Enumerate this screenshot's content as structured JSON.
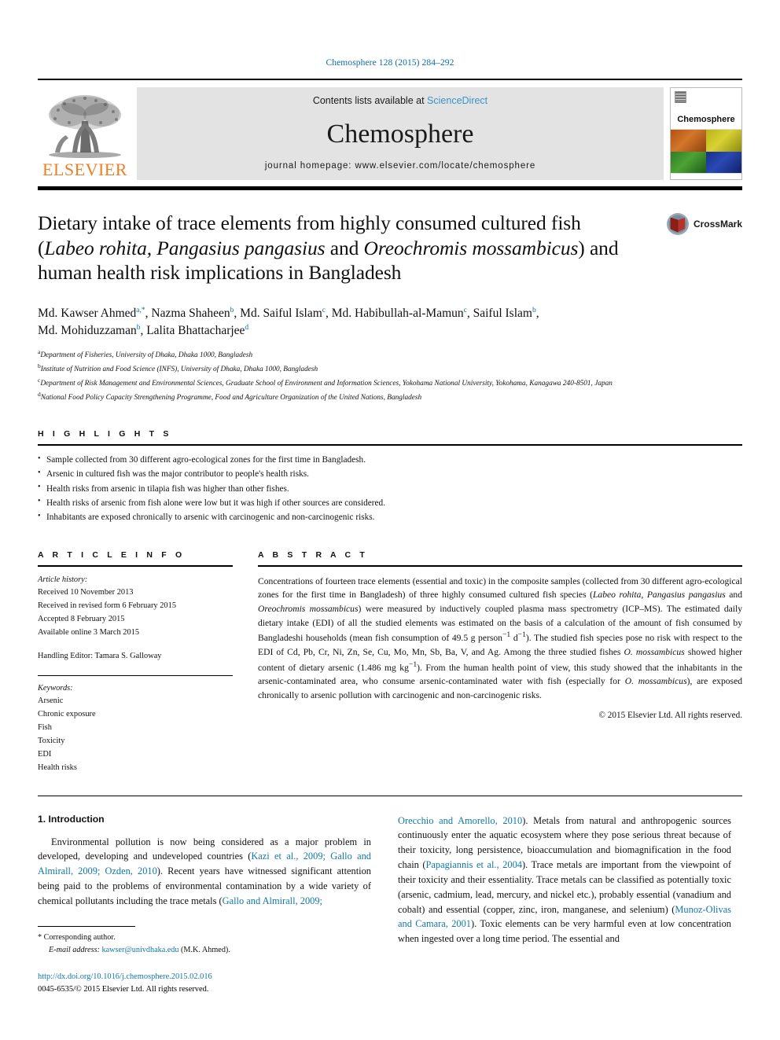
{
  "running_head": "Chemosphere 128 (2015) 284–292",
  "masthead": {
    "publisher_name": "ELSEVIER",
    "contents_prefix": "Contents lists available at",
    "sciencedirect": "ScienceDirect",
    "journal_name": "Chemosphere",
    "homepage": "journal homepage: www.elsevier.com/locate/chemosphere",
    "cover_title": "Chemosphere"
  },
  "title": {
    "line1": "Dietary intake of trace elements from highly consumed cultured fish",
    "line2_pre": "(",
    "line2_it1": "Labeo rohita, Pangasius pangasius",
    "line2_mid": " and ",
    "line2_it2": "Oreochromis mossambicus",
    "line2_post": ") and",
    "line3": "human health risk implications in Bangladesh",
    "crossmark_label": "CrossMark"
  },
  "authors": {
    "list": [
      {
        "name": "Md. Kawser Ahmed",
        "sup": "a,*",
        "sep": ", "
      },
      {
        "name": "Nazma Shaheen",
        "sup": "b",
        "sep": ", "
      },
      {
        "name": "Md. Saiful Islam",
        "sup": "c",
        "sep": ", "
      },
      {
        "name": "Md. Habibullah-al-Mamun",
        "sup": "c",
        "sep": ", "
      },
      {
        "name": "Saiful Islam",
        "sup": "b",
        "sep": ", "
      },
      {
        "name": "Md. Mohiduzzaman",
        "sup": "b",
        "sep": ", "
      },
      {
        "name": "Lalita Bhattacharjee",
        "sup": "d",
        "sep": ""
      }
    ]
  },
  "affiliations": [
    {
      "marker": "a",
      "text": "Department of Fisheries, University of Dhaka, Dhaka 1000, Bangladesh"
    },
    {
      "marker": "b",
      "text": "Institute of Nutrition and Food Science (INFS), University of Dhaka, Dhaka 1000, Bangladesh"
    },
    {
      "marker": "c",
      "text": "Department of Risk Management and Environmental Sciences, Graduate School of Environment and Information Sciences, Yokohama National University, Yokohama, Kanagawa 240-8501, Japan"
    },
    {
      "marker": "d",
      "text": "National Food Policy Capacity Strengthening Programme, Food and Agriculture Organization of the United Nations, Bangladesh"
    }
  ],
  "highlights": {
    "label": "H I G H L I G H T S",
    "items": [
      "Sample collected from 30 different agro-ecological zones for the first time in Bangladesh.",
      "Arsenic in cultured fish was the major contributor to people's health risks.",
      "Health risks from arsenic in tilapia fish was higher than other fishes.",
      "Health risks of arsenic from fish alone were low but it was high if other sources are considered.",
      "Inhabitants are exposed chronically to arsenic with carcinogenic and non-carcinogenic risks."
    ]
  },
  "article_info": {
    "label": "A R T I C L E  I N F O",
    "history_title": "Article history:",
    "history": [
      "Received 10 November 2013",
      "Received in revised form 6 February 2015",
      "Accepted 8 February 2015",
      "Available online 3 March 2015"
    ],
    "handling_editor": "Handling Editor: Tamara S. Galloway",
    "keywords_title": "Keywords:",
    "keywords": [
      "Arsenic",
      "Chronic exposure",
      "Fish",
      "Toxicity",
      "EDI",
      "Health risks"
    ]
  },
  "abstract": {
    "label": "A B S T R A C T",
    "p1": "Concentrations of fourteen trace elements (essential and toxic) in the composite samples (collected from 30 different agro-ecological zones for the first time in Bangladesh) of three highly consumed cultured fish species (",
    "species1": "Labeo rohita, Pangasius pangasius",
    "p2": " and ",
    "species2": "Oreochromis mossambicus",
    "p3": ") were measured by inductively coupled plasma mass spectrometry (ICP–MS). The estimated daily dietary intake (EDI) of all the studied elements was estimated on the basis of a calculation of the amount of fish consumed by Bangladeshi households (mean fish consumption of 49.5 g person",
    "sup1": "−1",
    "p4": " d",
    "sup2": "−1",
    "p5": "). The studied fish species pose no risk with respect to the EDI of Cd, Pb, Cr, Ni, Zn, Se, Cu, Mo, Mn, Sb, Ba, V, and Ag. Among the three studied fishes ",
    "species3": "O. mossambicus",
    "p6": " showed higher content of dietary arsenic (1.486 mg kg",
    "sup3": "−1",
    "p7": "). From the human health point of view, this study showed that the inhabitants in the arsenic-contaminated area, who consume arsenic-contaminated water with fish (especially for ",
    "species4": "O. mossambicus",
    "p8": "), are exposed chronically to arsenic pollution with carcinogenic and non-carcinogenic risks.",
    "copyright": "© 2015 Elsevier Ltd. All rights reserved."
  },
  "introduction": {
    "heading": "1. Introduction",
    "left_p1_a": "Environmental pollution is now being considered as a major problem in developed, developing and undeveloped countries (",
    "left_cite1": "Kazi et al., 2009; Gallo and Almirall, 2009; Ozden, 2010",
    "left_p1_b": "). Recent years have witnessed significant attention being paid to the problems of environmental contamination by a wide variety of chemical pollutants including the trace metals (",
    "left_cite2": "Gallo and Almirall, 2009;",
    "right_cite1": "Orecchio and Amorello, 2010",
    "right_p1_a": "). Metals from natural and anthropogenic sources continuously enter the aquatic ecosystem where they pose serious threat because of their toxicity, long persistence, bioaccumulation and biomagnification in the food chain (",
    "right_cite2": "Papagiannis et al., 2004",
    "right_p1_b": "). Trace metals are important from the viewpoint of their toxicity and their essentiality. Trace metals can be classified as potentially toxic (arsenic, cadmium, lead, mercury, and nickel etc.), probably essential (vanadium and cobalt) and essential (copper, zinc, iron, manganese, and selenium) (",
    "right_cite3": "Munoz-Olivas and Camara, 2001",
    "right_p1_c": "). Toxic elements can be very harmful even at low concentration when ingested over a long time period. The essential and"
  },
  "footer": {
    "corresponding_marker": "*",
    "corresponding_label": "Corresponding author.",
    "email_label": "E-mail address:",
    "email": "kawser@univdhaka.edu",
    "email_suffix": "(M.K. Ahmed).",
    "doi": "http://dx.doi.org/10.1016/j.chemosphere.2015.02.016",
    "issn_line": "0045-6535/© 2015 Elsevier Ltd. All rights reserved."
  },
  "colors": {
    "link": "#1177ab",
    "running_head": "#0b6ca8",
    "elsevier_orange": "#ef7d22",
    "sciencedirect": "#3b93c9",
    "masthead_bg": "#e3e3e3"
  }
}
